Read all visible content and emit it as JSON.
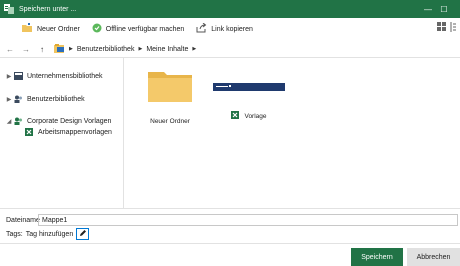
{
  "window": {
    "title": "Speichern unter ...",
    "minimize_symbol": "—",
    "maximize_symbol": "☐",
    "close_symbol": "✕"
  },
  "toolbar": {
    "new_folder": "Neuer Ordner",
    "offline": "Offline verfügbar machen",
    "copy_link": "Link kopieren"
  },
  "address": {
    "crumbs": [
      "Benutzerbibliothek",
      "Meine Inhalte"
    ],
    "back_symbol": "←",
    "forward_symbol": "→",
    "up_symbol": "↑"
  },
  "nav": {
    "items": [
      {
        "label": "Unternehmensbibliothek",
        "expander": "▶"
      },
      {
        "label": "Benutzerbibliothek",
        "expander": "▶"
      },
      {
        "label": "Corporate Design Vorlagen",
        "expander": "◢"
      },
      {
        "label": "Arbeitsmappenvorlagen",
        "expander": ""
      }
    ]
  },
  "content": {
    "items": [
      {
        "label": "Neuer Ordner",
        "type": "folder"
      },
      {
        "label": "Vorlage",
        "type": "excel-file"
      }
    ]
  },
  "form": {
    "filename_label": "Dateiname",
    "filename_value": "Mappe1",
    "tags_label": "Tags:",
    "tags_placeholder": "Tag hinzufügen"
  },
  "buttons": {
    "save": "Speichern",
    "cancel": "Abbrechen"
  },
  "colors": {
    "accent": "#217346",
    "focus": "#0078d4",
    "folder": "#f0c45e",
    "thumbnail_bar": "#1f3a6e"
  }
}
